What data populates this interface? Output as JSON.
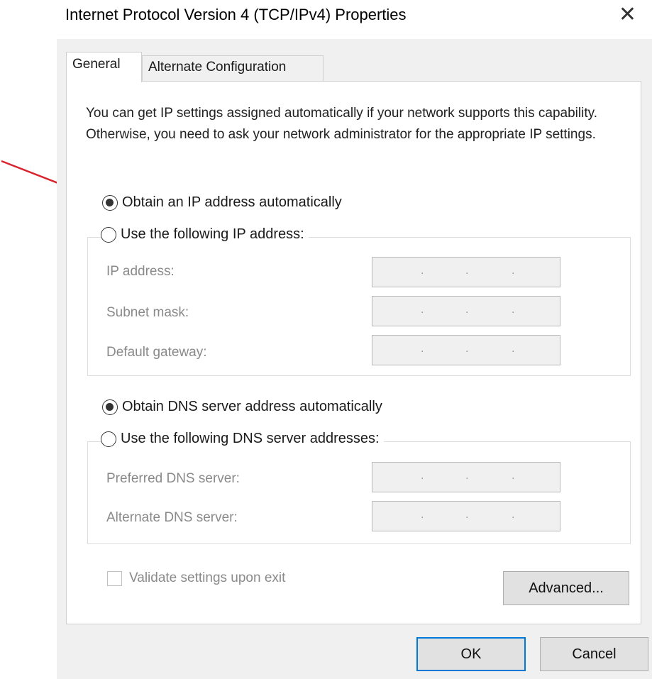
{
  "window": {
    "title": "Internet Protocol Version 4 (TCP/IPv4) Properties",
    "close_glyph": "✕"
  },
  "tabs": [
    {
      "label": "General",
      "active": true
    },
    {
      "label": "Alternate Configuration",
      "active": false
    }
  ],
  "intro_text": "You can get IP settings assigned automatically if your network supports this capability. Otherwise, you need to ask your network administrator for the appropriate IP settings.",
  "ip_section": {
    "auto_label": "Obtain an IP address automatically",
    "auto_selected": true,
    "manual_label": "Use the following IP address:",
    "manual_selected": false,
    "fields": [
      {
        "label": "IP address:",
        "value": ". . ."
      },
      {
        "label": "Subnet mask:",
        "value": ". . ."
      },
      {
        "label": "Default gateway:",
        "value": ". . ."
      }
    ]
  },
  "dns_section": {
    "auto_label": "Obtain DNS server address automatically",
    "auto_selected": true,
    "manual_label": "Use the following DNS server addresses:",
    "manual_selected": false,
    "fields": [
      {
        "label": "Preferred DNS server:",
        "value": ". . ."
      },
      {
        "label": "Alternate DNS server:",
        "value": ". . ."
      }
    ]
  },
  "validate": {
    "label": "Validate settings upon exit",
    "checked": false,
    "enabled": false
  },
  "buttons": {
    "advanced": "Advanced...",
    "ok": "OK",
    "cancel": "Cancel"
  },
  "colors": {
    "annotation_arrow": "#d9232e",
    "ok_focus_border": "#0078d7"
  },
  "annotation": {
    "icon": "red-arrow-icon"
  }
}
